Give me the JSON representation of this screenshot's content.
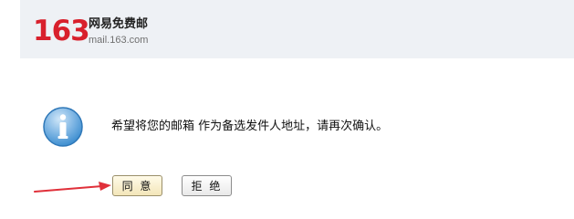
{
  "header": {
    "logo_number": "163",
    "logo_text": "网易免费邮",
    "logo_url": "mail.163.com"
  },
  "dialog": {
    "icon": "info-icon",
    "message": "希望将您的邮箱 作为备选发件人地址，请再次确认。",
    "agree_label": "同 意",
    "reject_label": "拒 绝"
  },
  "colors": {
    "brand_red": "#d8202c",
    "header_bg": "#eef1f5",
    "info_blue": "#3f8fd0",
    "arrow_red": "#e0303a"
  }
}
